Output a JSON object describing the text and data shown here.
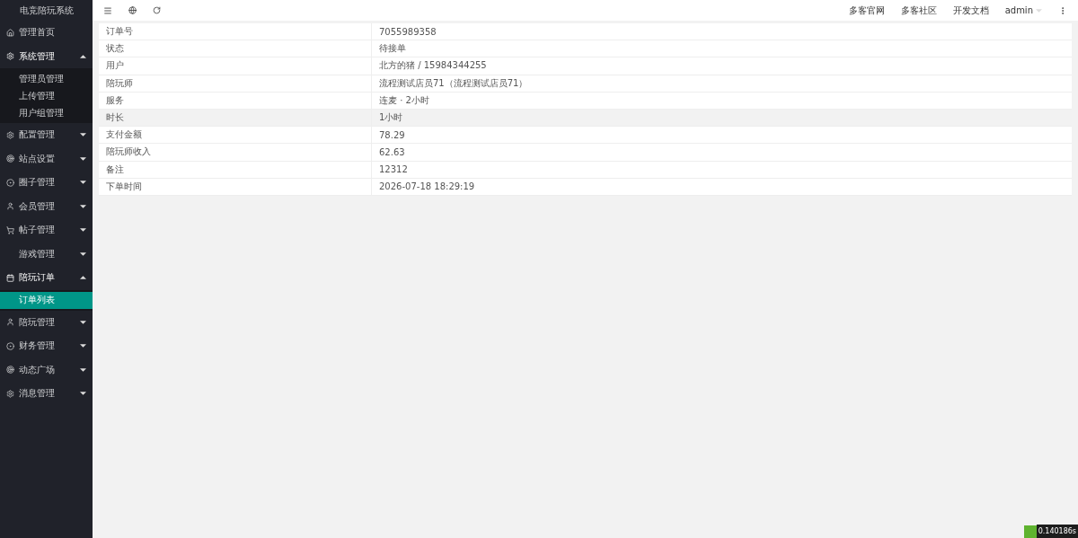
{
  "sidebar": {
    "title": "电竞陪玩系统",
    "items": [
      {
        "label": "管理首页",
        "expanded": false
      },
      {
        "label": "系统管理",
        "expanded": true,
        "children": [
          {
            "label": "管理员管理",
            "selected": false
          },
          {
            "label": "上传管理",
            "selected": false
          },
          {
            "label": "用户组管理",
            "selected": false
          }
        ]
      },
      {
        "label": "配置管理",
        "expanded": false
      },
      {
        "label": "站点设置",
        "expanded": false
      },
      {
        "label": "圈子管理",
        "expanded": false
      },
      {
        "label": "会员管理",
        "expanded": false
      },
      {
        "label": "帖子管理",
        "expanded": false
      },
      {
        "label": "游戏管理",
        "expanded": false
      },
      {
        "label": "陪玩订单",
        "expanded": true,
        "children": [
          {
            "label": "订单列表",
            "selected": true
          }
        ]
      },
      {
        "label": "陪玩管理",
        "expanded": false
      },
      {
        "label": "财务管理",
        "expanded": false
      },
      {
        "label": "动态广场",
        "expanded": false
      },
      {
        "label": "消息管理",
        "expanded": false
      }
    ]
  },
  "toolbar": {
    "links": [
      "多客官网",
      "多客社区",
      "开发文档"
    ],
    "user": "admin"
  },
  "details": [
    {
      "label": "订单号",
      "value": "7055989358",
      "highlighted": false
    },
    {
      "label": "状态",
      "value": "待接单",
      "highlighted": false
    },
    {
      "label": "用户",
      "value": "北方的猪 / 15984344255",
      "highlighted": false
    },
    {
      "label": "陪玩师",
      "value": "流程测试店员71（流程测试店员71）",
      "highlighted": false
    },
    {
      "label": "服务",
      "value": "连麦 · 2小时",
      "highlighted": false
    },
    {
      "label": "时长",
      "value": "1小时",
      "highlighted": true
    },
    {
      "label": "支付金额",
      "value": "78.29",
      "highlighted": false
    },
    {
      "label": "陪玩师收入",
      "value": "62.63",
      "highlighted": false
    },
    {
      "label": "备注",
      "value": "12312",
      "highlighted": false
    },
    {
      "label": "下单时间",
      "value": "2026-07-18 18:29:19",
      "highlighted": false
    }
  ],
  "debug_badge": "0.140186s"
}
